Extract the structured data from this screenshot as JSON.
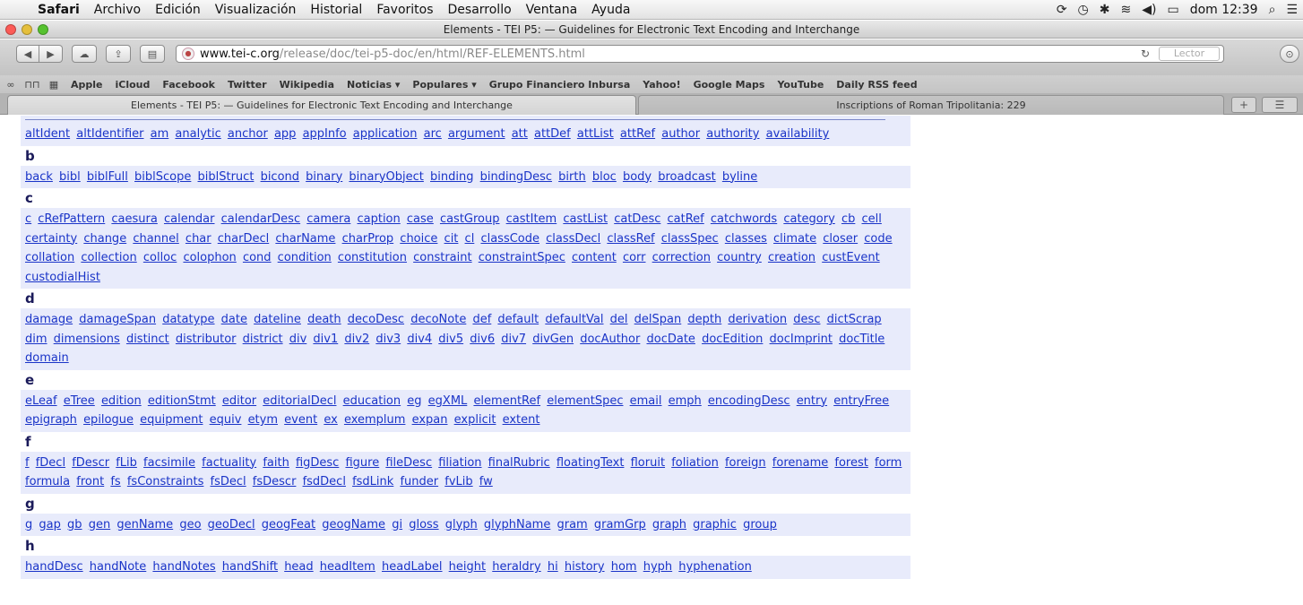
{
  "menubar": {
    "items": [
      "Safari",
      "Archivo",
      "Edición",
      "Visualización",
      "Historial",
      "Favoritos",
      "Desarrollo",
      "Ventana",
      "Ayuda"
    ],
    "clock": "dom 12:39"
  },
  "window": {
    "title": "Elements - TEI P5: — Guidelines for Electronic Text Encoding and Interchange"
  },
  "toolbar": {
    "url_host": "www.tei-c.org",
    "url_path": "/release/doc/tei-p5-doc/en/html/REF-ELEMENTS.html",
    "reader_label": "Lector"
  },
  "bookmarks": [
    "Apple",
    "iCloud",
    "Facebook",
    "Twitter",
    "Wikipedia",
    "Noticias ▾",
    "Populares ▾",
    "Grupo Financiero Inbursa",
    "Yahoo!",
    "Google Maps",
    "YouTube",
    "Daily RSS feed"
  ],
  "tabs": [
    {
      "label": "Elements - TEI P5: — Guidelines for Electronic Text Encoding and Interchange"
    },
    {
      "label": "Inscriptions of Roman Tripolitania: 229"
    }
  ],
  "sections": [
    {
      "letter": "",
      "items": [
        "altIdent",
        "altIdentifier",
        "am",
        "analytic",
        "anchor",
        "app",
        "appInfo",
        "application",
        "arc",
        "argument",
        "att",
        "attDef",
        "attList",
        "attRef",
        "author",
        "authority",
        "availability"
      ]
    },
    {
      "letter": "b",
      "items": [
        "back",
        "bibl",
        "biblFull",
        "biblScope",
        "biblStruct",
        "bicond",
        "binary",
        "binaryObject",
        "binding",
        "bindingDesc",
        "birth",
        "bloc",
        "body",
        "broadcast",
        "byline"
      ]
    },
    {
      "letter": "c",
      "items": [
        "c",
        "cRefPattern",
        "caesura",
        "calendar",
        "calendarDesc",
        "camera",
        "caption",
        "case",
        "castGroup",
        "castItem",
        "castList",
        "catDesc",
        "catRef",
        "catchwords",
        "category",
        "cb",
        "cell",
        "certainty",
        "change",
        "channel",
        "char",
        "charDecl",
        "charName",
        "charProp",
        "choice",
        "cit",
        "cl",
        "classCode",
        "classDecl",
        "classRef",
        "classSpec",
        "classes",
        "climate",
        "closer",
        "code",
        "collation",
        "collection",
        "colloc",
        "colophon",
        "cond",
        "condition",
        "constitution",
        "constraint",
        "constraintSpec",
        "content",
        "corr",
        "correction",
        "country",
        "creation",
        "custEvent",
        "custodialHist"
      ]
    },
    {
      "letter": "d",
      "items": [
        "damage",
        "damageSpan",
        "datatype",
        "date",
        "dateline",
        "death",
        "decoDesc",
        "decoNote",
        "def",
        "default",
        "defaultVal",
        "del",
        "delSpan",
        "depth",
        "derivation",
        "desc",
        "dictScrap",
        "dim",
        "dimensions",
        "distinct",
        "distributor",
        "district",
        "div",
        "div1",
        "div2",
        "div3",
        "div4",
        "div5",
        "div6",
        "div7",
        "divGen",
        "docAuthor",
        "docDate",
        "docEdition",
        "docImprint",
        "docTitle",
        "domain"
      ]
    },
    {
      "letter": "e",
      "items": [
        "eLeaf",
        "eTree",
        "edition",
        "editionStmt",
        "editor",
        "editorialDecl",
        "education",
        "eg",
        "egXML",
        "elementRef",
        "elementSpec",
        "email",
        "emph",
        "encodingDesc",
        "entry",
        "entryFree",
        "epigraph",
        "epilogue",
        "equipment",
        "equiv",
        "etym",
        "event",
        "ex",
        "exemplum",
        "expan",
        "explicit",
        "extent"
      ]
    },
    {
      "letter": "f",
      "items": [
        "f",
        "fDecl",
        "fDescr",
        "fLib",
        "facsimile",
        "factuality",
        "faith",
        "figDesc",
        "figure",
        "fileDesc",
        "filiation",
        "finalRubric",
        "floatingText",
        "floruit",
        "foliation",
        "foreign",
        "forename",
        "forest",
        "form",
        "formula",
        "front",
        "fs",
        "fsConstraints",
        "fsDecl",
        "fsDescr",
        "fsdDecl",
        "fsdLink",
        "funder",
        "fvLib",
        "fw"
      ]
    },
    {
      "letter": "g",
      "items": [
        "g",
        "gap",
        "gb",
        "gen",
        "genName",
        "geo",
        "geoDecl",
        "geogFeat",
        "geogName",
        "gi",
        "gloss",
        "glyph",
        "glyphName",
        "gram",
        "gramGrp",
        "graph",
        "graphic",
        "group"
      ]
    },
    {
      "letter": "h",
      "items": [
        "handDesc",
        "handNote",
        "handNotes",
        "handShift",
        "head",
        "headItem",
        "headLabel",
        "height",
        "heraldry",
        "hi",
        "history",
        "hom",
        "hyph",
        "hyphenation"
      ]
    }
  ]
}
